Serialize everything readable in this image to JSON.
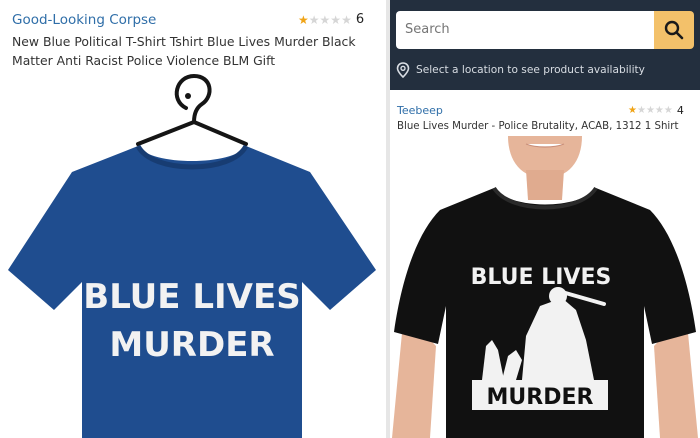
{
  "left_listing": {
    "brand": "Good-Looking Corpse",
    "rating_count": "6",
    "rating_stars": 1,
    "title": "New Blue Political T-Shirt Tshirt Blue Lives Murder Black Matter Anti Racist Police Violence BLM Gift",
    "shirt_text_line1": "BLUE LIVES",
    "shirt_text_line2": "MURDER",
    "shirt_color": "#1f4d8f"
  },
  "search": {
    "placeholder": "Search",
    "location_text": "Select a location to see product availability",
    "header_color": "#232f3e",
    "button_color": "#f3c16a"
  },
  "right_listing": {
    "brand": "Teebeep",
    "rating_count": "4",
    "rating_stars": 1,
    "title": "Blue Lives Murder - Police Brutality, ACAB, 1312 1 Shirt",
    "shirt_text_line1": "BLUE LIVES",
    "shirt_text_line2": "MURDER",
    "shirt_color": "#111111"
  }
}
